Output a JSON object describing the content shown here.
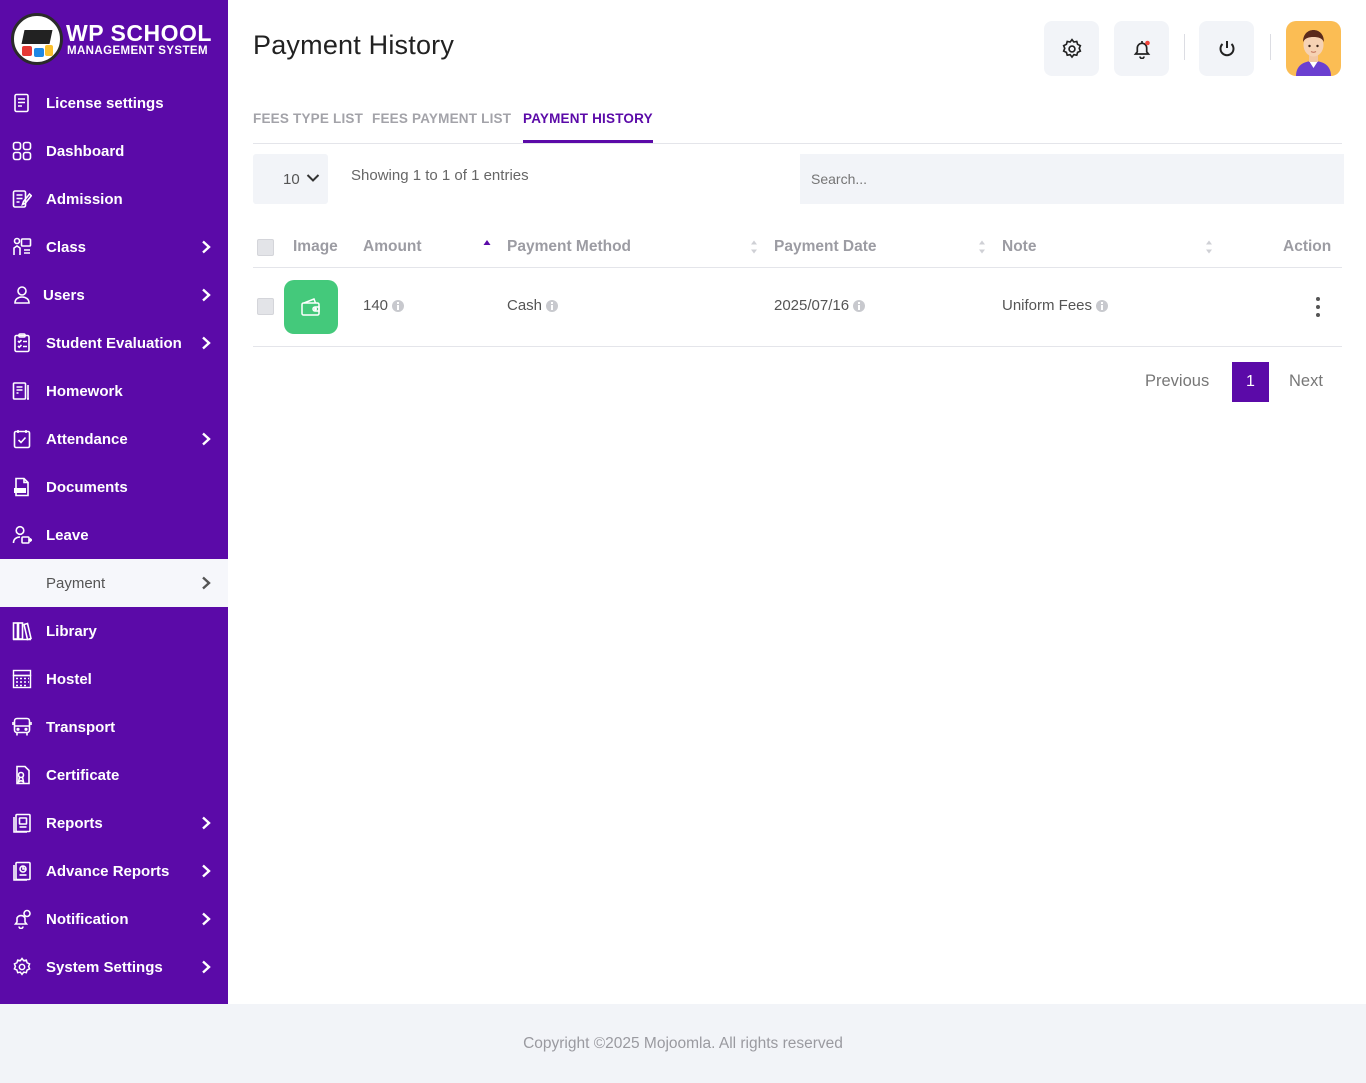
{
  "app": {
    "logo_title": "WP SCHOOL",
    "logo_subtitle": "MANAGEMENT SYSTEM"
  },
  "sidebar": {
    "items": [
      {
        "label": "License settings",
        "icon": "license-icon",
        "has_submenu": false
      },
      {
        "label": "Dashboard",
        "icon": "dashboard-grid-icon",
        "has_submenu": false
      },
      {
        "label": "Admission",
        "icon": "admission-icon",
        "has_submenu": false
      },
      {
        "label": "Class",
        "icon": "class-icon",
        "has_submenu": true
      },
      {
        "label": "Users",
        "icon": "user-icon",
        "has_submenu": true
      },
      {
        "label": "Student Evaluation",
        "icon": "evaluation-icon",
        "has_submenu": true
      },
      {
        "label": "Homework",
        "icon": "homework-icon",
        "has_submenu": false
      },
      {
        "label": "Attendance",
        "icon": "attendance-icon",
        "has_submenu": true
      },
      {
        "label": "Documents",
        "icon": "document-icon",
        "has_submenu": false
      },
      {
        "label": "Leave",
        "icon": "leave-icon",
        "has_submenu": false
      },
      {
        "label": "Payment",
        "icon": "payment-icon",
        "has_submenu": true,
        "active": true
      },
      {
        "label": "Library",
        "icon": "library-icon",
        "has_submenu": false
      },
      {
        "label": "Hostel",
        "icon": "hostel-icon",
        "has_submenu": false
      },
      {
        "label": "Transport",
        "icon": "bus-icon",
        "has_submenu": false
      },
      {
        "label": "Certificate",
        "icon": "certificate-icon",
        "has_submenu": false
      },
      {
        "label": "Reports",
        "icon": "reports-icon",
        "has_submenu": true
      },
      {
        "label": "Advance Reports",
        "icon": "advance-reports-icon",
        "has_submenu": true
      },
      {
        "label": "Notification",
        "icon": "notification-icon",
        "has_submenu": true
      },
      {
        "label": "System Settings",
        "icon": "gear-icon",
        "has_submenu": true
      }
    ]
  },
  "header": {
    "title": "Payment History",
    "buttons": [
      "gear-icon",
      "bell-icon",
      "power-icon"
    ]
  },
  "tabs": [
    {
      "label": "FEES TYPE LIST",
      "active": false
    },
    {
      "label": "FEES PAYMENT LIST",
      "active": false
    },
    {
      "label": "PAYMENT HISTORY",
      "active": true
    }
  ],
  "table_controls": {
    "page_length": "10",
    "info": "Showing 1 to 1 of 1 entries",
    "search_placeholder": "Search..."
  },
  "table": {
    "columns": [
      "Image",
      "Amount",
      "Payment Method",
      "Payment Date",
      "Note",
      "Action"
    ],
    "rows": [
      {
        "image_icon": "wallet-icon",
        "amount": "140",
        "payment_method": "Cash",
        "payment_date": "2025/07/16",
        "note": "Uniform Fees"
      }
    ]
  },
  "pagination": {
    "previous": "Previous",
    "current": "1",
    "next": "Next"
  },
  "footer": {
    "copyright": "Copyright ©2025 Mojoomla. All rights reserved"
  },
  "colors": {
    "sidebar_bg": "#5b0aa8",
    "accent": "#5b0aa8",
    "thumb_green": "#44c97b",
    "avatar_bg": "#fbbd54"
  }
}
